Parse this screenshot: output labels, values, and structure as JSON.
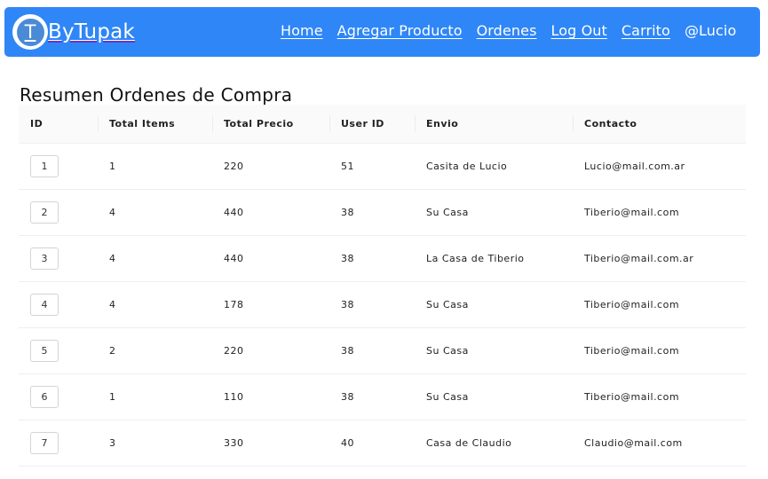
{
  "brand": {
    "logo_letter": "T",
    "name": "ByTupak"
  },
  "nav": {
    "links": [
      "Home",
      "Agregar Producto",
      "Ordenes",
      "Log Out",
      "Carrito"
    ],
    "user": "@Lucio"
  },
  "page": {
    "title": "Resumen Ordenes de Compra"
  },
  "table": {
    "headers": [
      "ID",
      "Total Items",
      "Total Precio",
      "User ID",
      "Envio",
      "Contacto"
    ],
    "rows": [
      {
        "id": "1",
        "items": "1",
        "precio": "220",
        "user_id": "51",
        "envio": "Casita de Lucio",
        "contacto": "Lucio@mail.com.ar"
      },
      {
        "id": "2",
        "items": "4",
        "precio": "440",
        "user_id": "38",
        "envio": "Su Casa",
        "contacto": "Tiberio@mail.com"
      },
      {
        "id": "3",
        "items": "4",
        "precio": "440",
        "user_id": "38",
        "envio": "La Casa de Tiberio",
        "contacto": "Tiberio@mail.com.ar"
      },
      {
        "id": "4",
        "items": "4",
        "precio": "178",
        "user_id": "38",
        "envio": "Su Casa",
        "contacto": "Tiberio@mail.com"
      },
      {
        "id": "5",
        "items": "2",
        "precio": "220",
        "user_id": "38",
        "envio": "Su Casa",
        "contacto": "Tiberio@mail.com"
      },
      {
        "id": "6",
        "items": "1",
        "precio": "110",
        "user_id": "38",
        "envio": "Su Casa",
        "contacto": "Tiberio@mail.com"
      },
      {
        "id": "7",
        "items": "3",
        "precio": "330",
        "user_id": "40",
        "envio": "Casa de Claudio",
        "contacto": "Claudio@mail.com"
      }
    ]
  },
  "colors": {
    "navbar": "#2f86f7",
    "logo_inner": "#4a8ad6"
  }
}
